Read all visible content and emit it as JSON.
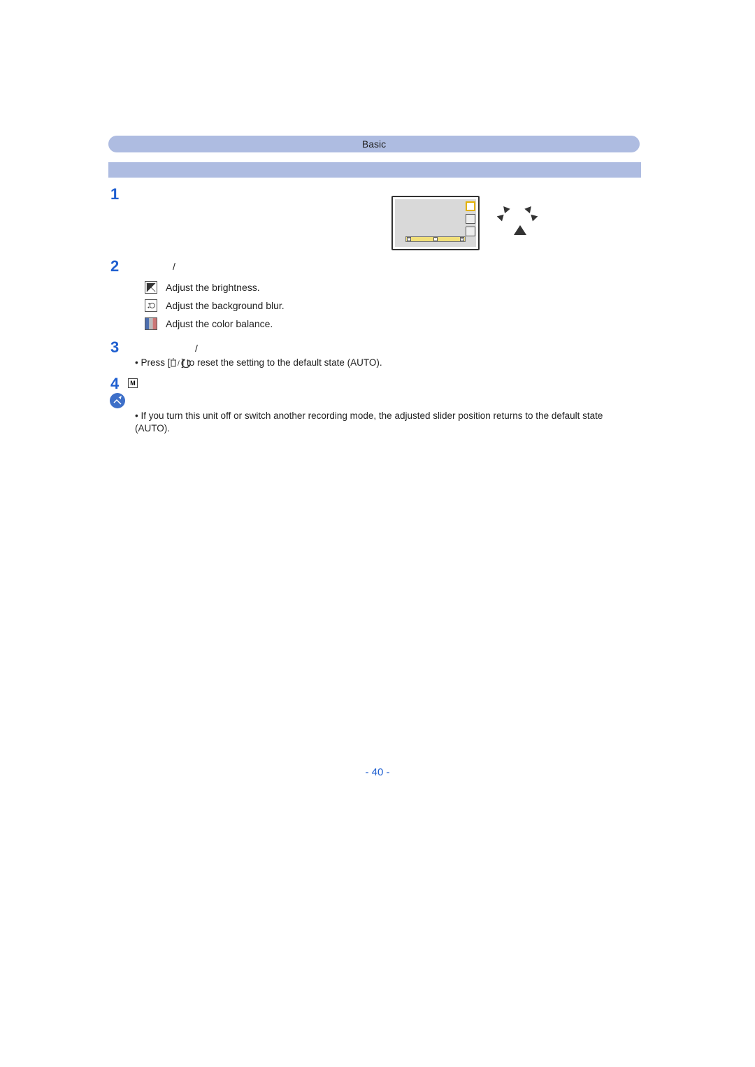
{
  "header": {
    "section": "Basic"
  },
  "steps": {
    "n1": "1",
    "n2": "2",
    "n3": "3",
    "n4": "4",
    "slash2": "/",
    "slash3": "/"
  },
  "options": {
    "brightness": "Adjust the brightness.",
    "blur": "Adjust the background blur.",
    "color": "Adjust the color balance."
  },
  "step3_sub_prefix": "• Press [",
  "step3_sub_suffix": "] to reset the setting to the default state (AUTO).",
  "step4_icon_label": "M",
  "note_bullet": "•",
  "note_text": "If you turn this unit off or switch another recording mode, the adjusted slider position returns to the default state (AUTO).",
  "page_number": "- 40 -",
  "icons": {
    "brightness": "exposure-compensation-icon",
    "blur": "defocus-icon",
    "color": "color-balance-icon",
    "delete_return": "trash-return-icon",
    "note": "note-icon"
  },
  "illustration": {
    "slider_minus": "−",
    "slider_center": "·",
    "slider_plus": "+"
  }
}
